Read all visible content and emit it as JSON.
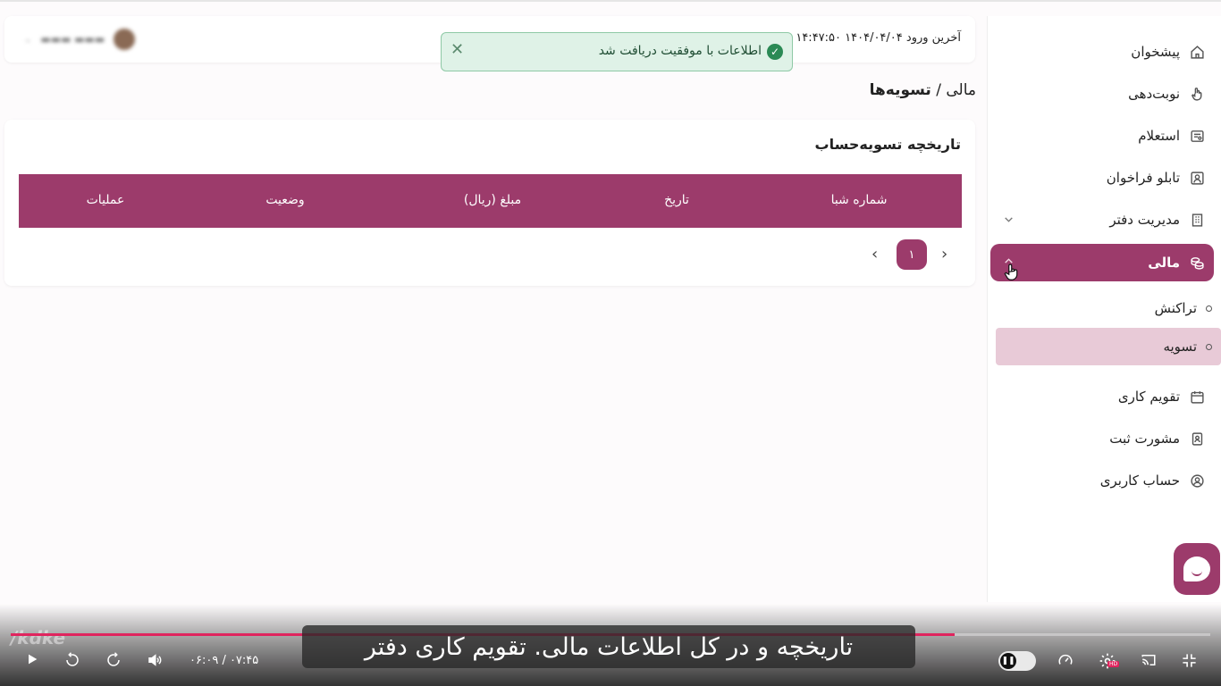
{
  "sidebar": {
    "items": [
      {
        "label": "پیشخوان",
        "icon": "home-icon"
      },
      {
        "label": "نوبت‌دهی",
        "icon": "hand-pointer-icon"
      },
      {
        "label": "استعلام",
        "icon": "inquiry-icon"
      },
      {
        "label": "تابلو فراخوان",
        "icon": "board-icon"
      },
      {
        "label": "مدیریت دفتر",
        "icon": "building-icon"
      },
      {
        "label": "مالی",
        "icon": "coins-icon"
      },
      {
        "label": "تقویم کاری",
        "icon": "calendar-icon"
      },
      {
        "label": "مشورت ثبت",
        "icon": "consult-icon"
      },
      {
        "label": "حساب کاربری",
        "icon": "user-circle-icon"
      }
    ],
    "finance_sub": [
      {
        "label": "تراکنش"
      },
      {
        "label": "تسویه"
      }
    ]
  },
  "header": {
    "last_login_label": "آخرین ورود",
    "last_login_value": "۱۴۰۴/۰۴/۰۴ ۱۴:۴۷:۵۰"
  },
  "toast": {
    "message": "اطلاعات با موفقیت دریافت شد"
  },
  "breadcrumb": {
    "parent": "مالی",
    "separator": " / ",
    "current": "تسویه‌ها"
  },
  "card": {
    "title": "تاریخچه تسویه‌حساب",
    "columns": [
      "شماره شبا",
      "تاریخ",
      "مبلغ (ریال)",
      "وضعیت",
      "عملیات"
    ]
  },
  "pagination": {
    "current_page": "۱"
  },
  "player": {
    "subtitle": "تاریخچه و در کل اطلاعات مالی. تقویم کاری دفتر",
    "time": "۰۶:۰۹ / ۰۷:۴۵",
    "watermark": "/kdke",
    "hd_badge": "HD",
    "progress_fraction": 0.787
  },
  "colors": {
    "primary": "#9c3b6b",
    "selected_sub": "#e8cad7",
    "toast_bg": "#dff2e7",
    "toast_check": "#2b8a55",
    "progress": "#e0245e"
  }
}
